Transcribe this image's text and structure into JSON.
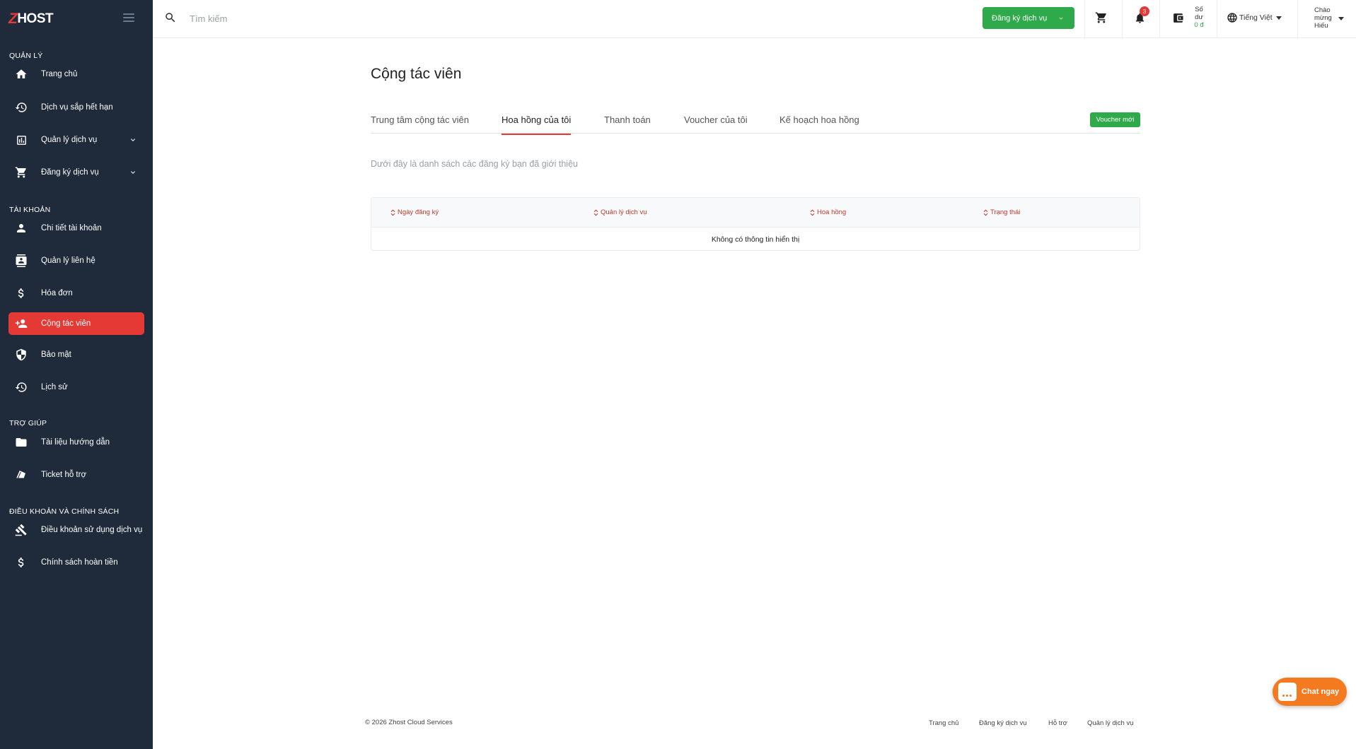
{
  "brand": {
    "logo_text": "HOST",
    "logo_letter": "Z"
  },
  "sidebar": {
    "sections": [
      {
        "title": "QUẢN LÝ"
      },
      {
        "title": "TÀI KHOẢN"
      },
      {
        "title": "TRỢ GIÚP"
      },
      {
        "title": "ĐIỀU KHOẢN VÀ CHÍNH SÁCH"
      }
    ],
    "items": [
      {
        "label": "Trang chủ",
        "icon": "home-icon"
      },
      {
        "label": "Dịch vụ sắp hết hạn",
        "icon": "history-icon"
      },
      {
        "label": "Quản lý dịch vụ",
        "icon": "services-icon"
      },
      {
        "label": "Đăng ký dịch vụ",
        "icon": "cart-icon"
      },
      {
        "label": "Chi tiết tài khoản",
        "icon": "user-icon"
      },
      {
        "label": "Quản lý liên hệ",
        "icon": "contact-icon"
      },
      {
        "label": "Hóa đơn",
        "icon": "dollar-icon"
      },
      {
        "label": "Cộng tác viên",
        "icon": "add-user-icon",
        "active": true
      },
      {
        "label": "Bảo mật",
        "icon": "shield-icon"
      },
      {
        "label": "Lịch sử",
        "icon": "history-icon"
      },
      {
        "label": "Tài liệu hướng dẫn",
        "icon": "folder-icon"
      },
      {
        "label": "Ticket hỗ trợ",
        "icon": "ticket-icon"
      },
      {
        "label": "Điều khoản sử dụng dịch vụ",
        "icon": "gavel-icon"
      },
      {
        "label": "Chính sách hoàn tiền",
        "icon": "dollar-icon"
      }
    ]
  },
  "topbar": {
    "search_placeholder": "Tìm kiếm",
    "register_button": "Đăng ký dịch vụ",
    "notification_count": "3",
    "balance_label_1": "Số",
    "balance_label_2": "dư",
    "balance_amount": "0 đ",
    "language": "Tiếng Việt",
    "greeting_1": "Chào",
    "greeting_2": "mừng",
    "greeting_3": "Hiếu"
  },
  "main": {
    "title": "Cộng tác viên",
    "tabs": [
      {
        "label": "Trung tâm cộng tác viên"
      },
      {
        "label": "Hoa hồng của tôi",
        "active": true
      },
      {
        "label": "Thanh toán"
      },
      {
        "label": "Voucher của tôi"
      },
      {
        "label": "Kế hoạch hoa hồng"
      }
    ],
    "voucher_button": "Voucher mới",
    "subtitle": "Dưới đây là danh sách các đăng ký bạn đã giới thiệu",
    "table": {
      "columns": [
        "Ngày đăng ký",
        "Quản lý dịch vụ",
        "Hoa hồng",
        "Trạng thái"
      ],
      "empty_text": "Không có thông tin hiển thị"
    }
  },
  "footer": {
    "copyright": "© 2026 Zhost Cloud Services",
    "links": [
      "Trang chủ",
      "Đăng ký dịch vụ",
      "Hỗ trợ",
      "Quản lý dịch vụ"
    ]
  },
  "chat": {
    "label": "Chat ngay"
  },
  "colors": {
    "sidebar_bg": "#1f2a3a",
    "accent_red": "#e53935",
    "green": "#2eaa4a",
    "chat_orange": "#f47a20"
  }
}
